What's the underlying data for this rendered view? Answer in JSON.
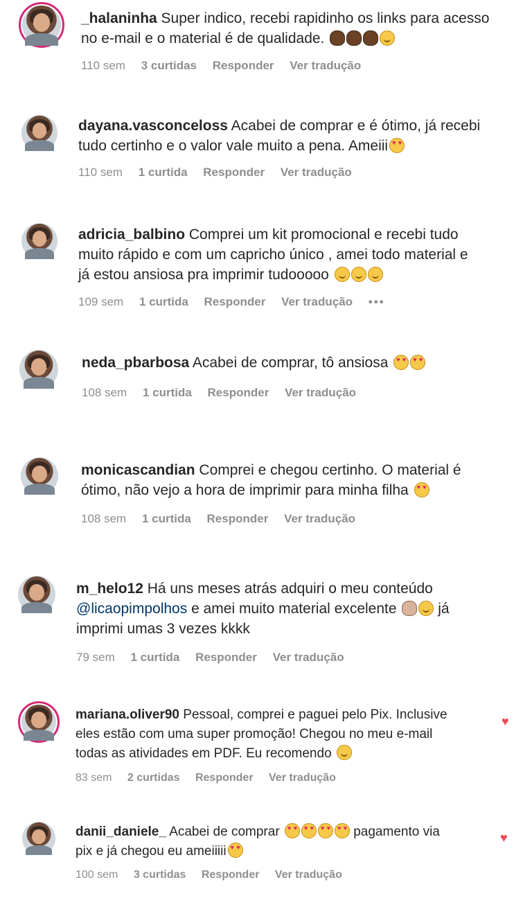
{
  "comments": [
    {
      "username": "_halaninha",
      "text_lines": [
        "Super indico, recebi rapidinho os links para acesso",
        "no e-mail e o material é de qualidade."
      ],
      "emojis_line2": [
        "clap-dark-icon",
        "clap-dark-icon",
        "clap-dark-icon",
        "smiling-face-icon"
      ],
      "time": "110 sem",
      "likes": "3 curtidas",
      "reply": "Responder",
      "translate": "Ver tradução",
      "story_ring": true,
      "liked_by_author": false
    },
    {
      "username": "dayana.vasconceloss",
      "text_lines": [
        "Acabei de comprar e é ótimo, já recebi",
        "tudo certinho e o valor vale muito a pena. Ameiii"
      ],
      "emojis_line2": [
        "heart-eyes-icon"
      ],
      "time": "110 sem",
      "likes": "1 curtida",
      "reply": "Responder",
      "translate": "Ver tradução",
      "story_ring": false,
      "liked_by_author": false
    },
    {
      "username": "adricia_balbino",
      "text_lines": [
        "Comprei um kit promocional e recebi tudo",
        "muito rápido e com um capricho único , amei todo material e",
        "já estou ansiosa pra imprimir tudooooo"
      ],
      "emojis_line3": [
        "smiling-hearts-icon",
        "smiling-hearts-icon",
        "smiling-hearts-icon"
      ],
      "time": "109 sem",
      "likes": "1 curtida",
      "reply": "Responder",
      "translate": "Ver tradução",
      "more": "•••",
      "story_ring": false,
      "liked_by_author": false
    },
    {
      "username": "neda_pbarbosa",
      "text_lines": [
        "Acabei de comprar, tô ansiosa"
      ],
      "emojis_line1": [
        "heart-eyes-icon",
        "heart-eyes-icon"
      ],
      "time": "108 sem",
      "likes": "1 curtida",
      "reply": "Responder",
      "translate": "Ver tradução",
      "story_ring": false,
      "liked_by_author": false
    },
    {
      "username": "monicascandian",
      "text_lines": [
        "Comprei e chegou certinho. O material é",
        "ótimo, não vejo a hora de imprimir para minha filha"
      ],
      "emojis_line2": [
        "heart-eyes-icon"
      ],
      "time": "108 sem",
      "likes": "1 curtida",
      "reply": "Responder",
      "translate": "Ver tradução",
      "story_ring": false,
      "liked_by_author": false
    },
    {
      "username": "m_helo12",
      "text_lines": [
        "Há uns meses atrás adquiri o meu conteúdo"
      ],
      "mention": "@licaopimpolhos",
      "after_mention": "e amei muito material excelente",
      "after_emojis": "já",
      "last_line": "imprimi umas 3 vezes kkkk",
      "emojis_line2": [
        "clap-light-icon",
        "smiling-face-icon"
      ],
      "time": "79 sem",
      "likes": "1 curtida",
      "reply": "Responder",
      "translate": "Ver tradução",
      "story_ring": false,
      "liked_by_author": false
    },
    {
      "username": "mariana.oliver90",
      "text_lines": [
        "Pessoal, comprei e paguei pelo Pix. Inclusive",
        "eles estão com uma super promoção! Chegou no meu e-mail",
        "todas as atividades em PDF. Eu recomendo"
      ],
      "emojis_line3": [
        "smiling-face-icon"
      ],
      "time": "83 sem",
      "likes": "2 curtidas",
      "reply": "Responder",
      "translate": "Ver tradução",
      "story_ring": true,
      "liked_by_author": true
    },
    {
      "username": "danii_daniele_",
      "text_first": "Acabei de comprar",
      "text_after": "pagamento via",
      "text_line2": "pix e já chegou eu ameiiiii",
      "emojis_line1": [
        "heart-eyes-icon",
        "heart-eyes-icon",
        "heart-eyes-icon",
        "heart-eyes-icon"
      ],
      "emojis_line2": [
        "heart-eyes-icon"
      ],
      "time": "100 sem",
      "likes": "3 curtidas",
      "reply": "Responder",
      "translate": "Ver tradução",
      "story_ring": false,
      "liked_by_author": true
    }
  ],
  "colors": {
    "text": "#262626",
    "meta": "#8e8e8e",
    "mention": "#00376b",
    "heart": "#ed4956",
    "story_ring": "#d62976"
  }
}
